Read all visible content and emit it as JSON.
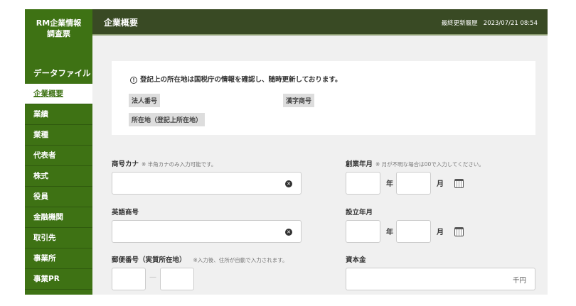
{
  "sidebar": {
    "title_line1": "RM企業情報",
    "title_line2": "調査票",
    "data_file": "データファイル",
    "items": [
      {
        "label": "企業概要",
        "active": true
      },
      {
        "label": "業績"
      },
      {
        "label": "業種"
      },
      {
        "label": "代表者"
      },
      {
        "label": "株式"
      },
      {
        "label": "役員"
      },
      {
        "label": "金融機関"
      },
      {
        "label": "取引先"
      },
      {
        "label": "事業所"
      },
      {
        "label": "事業PR"
      }
    ]
  },
  "header": {
    "title": "企業概要",
    "last_updated_label": "最終更新履歴",
    "last_updated_value": "2023/07/21 08:54"
  },
  "notice": {
    "icon": "info-circle-icon",
    "text": "登記上の所在地は国税庁の情報を確認し、随時更新しております。",
    "tags": [
      "法人番号",
      "漢字商号",
      "所在地（登記上所在地）"
    ]
  },
  "form": {
    "kana": {
      "label": "商号カナ",
      "note": "※ 半角カナのみ入力可能です。",
      "value": ""
    },
    "english": {
      "label": "英語商号",
      "value": ""
    },
    "postal": {
      "label": "郵便番号（実質所在地）",
      "note": "※入力後、住所が自動で入力されます。",
      "sep": "—"
    },
    "founded": {
      "label": "創業年月",
      "note": "※ 月が不明な場合は00で入力してください。",
      "year_unit": "年",
      "month_unit": "月"
    },
    "established": {
      "label": "設立年月",
      "year_unit": "年",
      "month_unit": "月"
    },
    "capital": {
      "label": "資本金",
      "unit": "千円"
    }
  },
  "colors": {
    "sidebar": "#3e7214",
    "header": "#394a24",
    "background": "#f0f0f0"
  }
}
